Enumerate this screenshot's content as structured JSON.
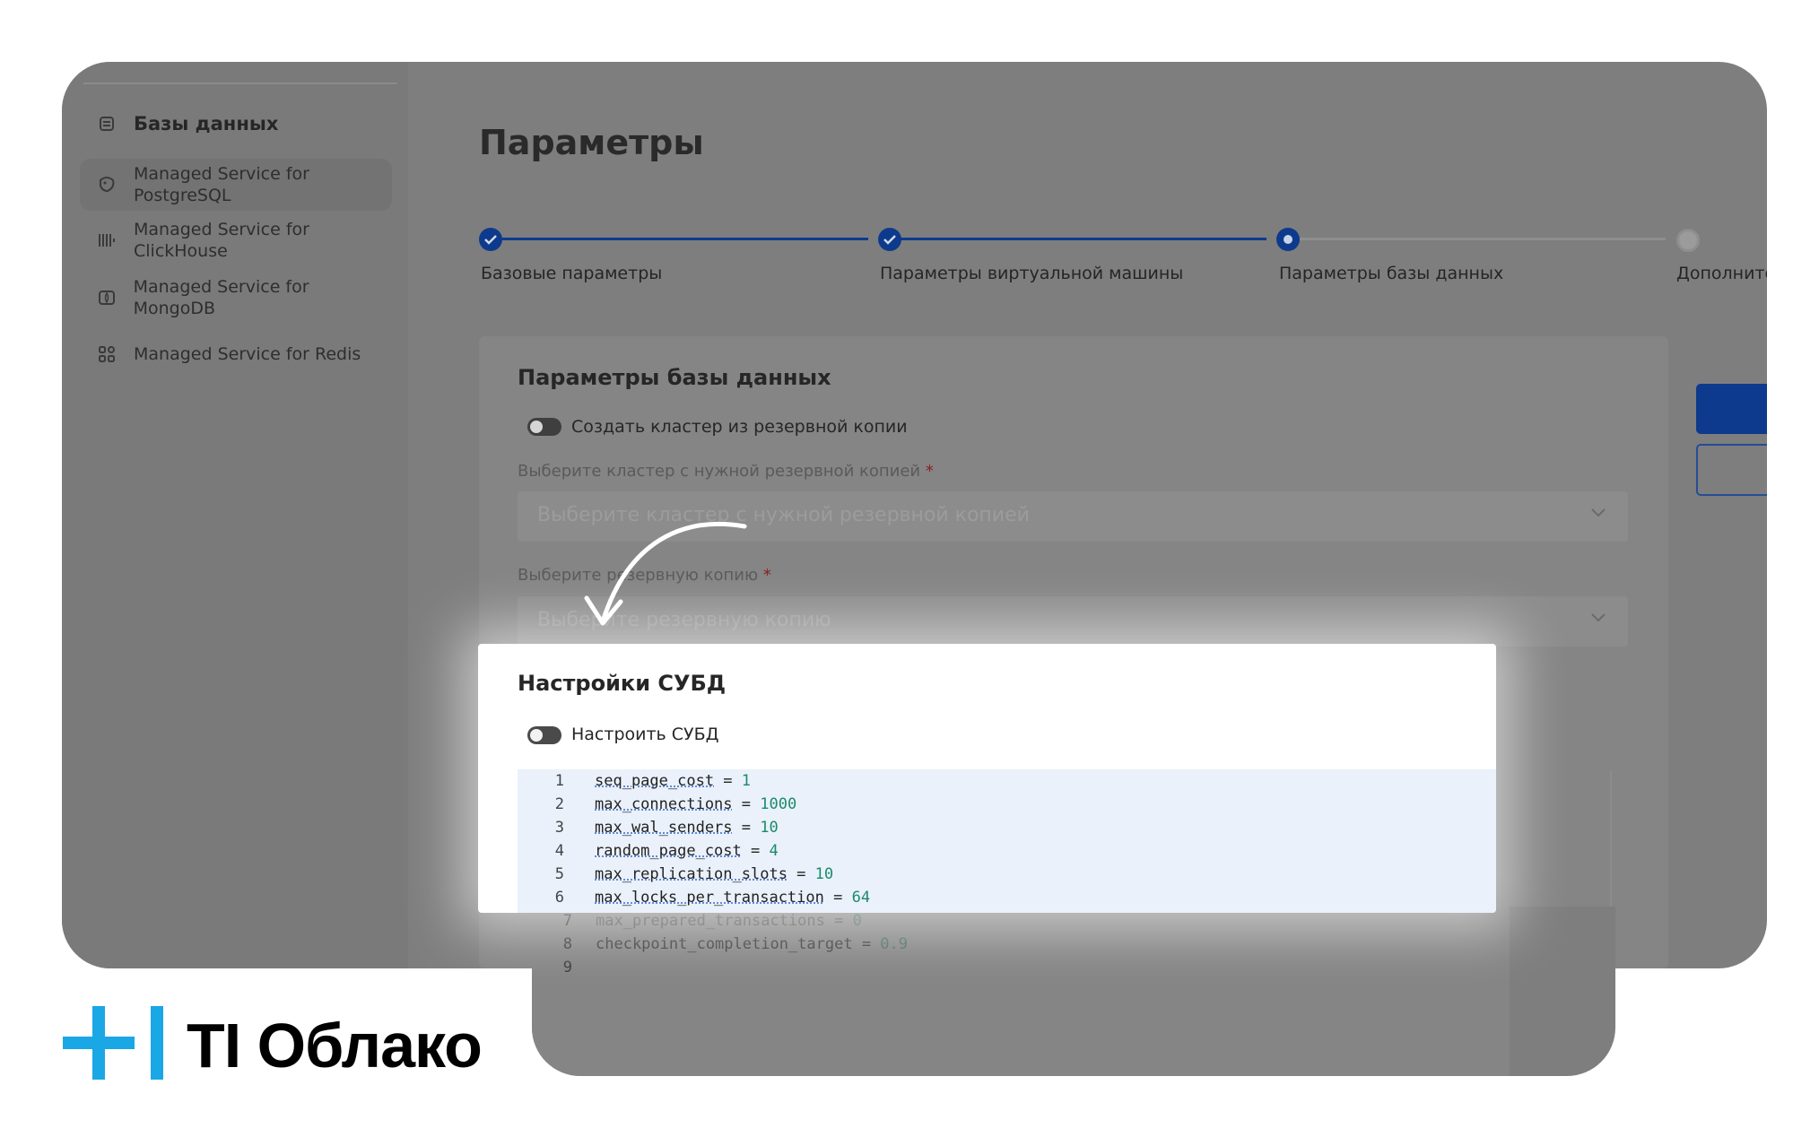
{
  "sidebar": {
    "header": "Базы данных",
    "items": [
      {
        "label_line1": "Managed Service for",
        "label_line2": "PostgreSQL",
        "icon": "postgresql-icon",
        "active": true
      },
      {
        "label_line1": "Managed Service for",
        "label_line2": "ClickHouse",
        "icon": "clickhouse-icon",
        "active": false
      },
      {
        "label_line1": "Managed Service for MongoDB",
        "label_line2": "",
        "icon": "mongodb-icon",
        "active": false
      },
      {
        "label_line1": "Managed Service for Redis",
        "label_line2": "",
        "icon": "redis-icon",
        "active": false
      }
    ]
  },
  "page": {
    "title": "Параметры"
  },
  "steps": [
    {
      "label": "Базовые параметры",
      "state": "done"
    },
    {
      "label": "Параметры виртуальной машины",
      "state": "done"
    },
    {
      "label": "Параметры базы данных",
      "state": "current"
    },
    {
      "label": "Дополните",
      "state": "pending"
    }
  ],
  "db_params": {
    "title": "Параметры базы данных",
    "backup_toggle_label": "Создать кластер из резервной копии",
    "cluster_label": "Выберите кластер с нужной резервной копией",
    "cluster_placeholder": "Выберите кластер с нужной резервной копией",
    "backup_label": "Выберите резервную копию",
    "backup_placeholder": "Выберите резервную копию",
    "required_mark": "*"
  },
  "dbms": {
    "title": "Настройки СУБД",
    "toggle_label": "Настроить СУБД",
    "lines": [
      {
        "n": "1",
        "key": "seq_page_cost",
        "value": "1"
      },
      {
        "n": "2",
        "key": "max_connections",
        "value": "1000"
      },
      {
        "n": "3",
        "key": "max_wal_senders",
        "value": "10"
      },
      {
        "n": "4",
        "key": "random_page_cost",
        "value": "4"
      },
      {
        "n": "5",
        "key": "max_replication_slots",
        "value": "10"
      },
      {
        "n": "6",
        "key": "max_locks_per_transaction",
        "value": "64"
      },
      {
        "n": "7",
        "key": "max_prepared_transactions",
        "value": "0"
      },
      {
        "n": "8",
        "key": "checkpoint_completion_target",
        "value": "0.9"
      },
      {
        "n": "9",
        "key": "",
        "value": ""
      }
    ]
  },
  "brand": {
    "name": "TI Облако",
    "accent": "#1aa7e6"
  },
  "colors": {
    "primary": "#0d3a8c",
    "step_active": "#0d3a8c",
    "code_bg": "#eaf1fb",
    "code_number": "#1c8a6a"
  }
}
